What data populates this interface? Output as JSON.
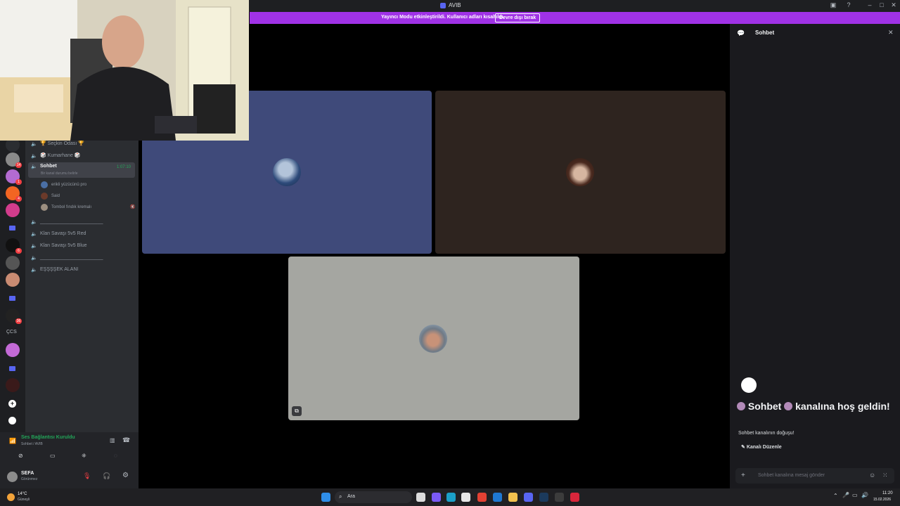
{
  "window": {
    "title": "AVIB",
    "minimize": "–",
    "maximize": "□",
    "close": "✕"
  },
  "banner": {
    "message": "Yayıncı Modu etkinleştirildi. Kullanıcı adları kısaltıldı.",
    "button": "Devre dışı bırak"
  },
  "servers": {
    "badges": [
      "14",
      "1",
      "4",
      "6",
      "36"
    ],
    "text_server": "ÇCS"
  },
  "channels": {
    "items": [
      {
        "label": "🏆 Seçkin Odası 🏆"
      },
      {
        "label": "🎲 Kumarhane 🎲"
      },
      {
        "label": "Sohbet",
        "status": "Bir kanal durumu belirle",
        "timer": "1:07:10"
      },
      {
        "label": "_______________________"
      },
      {
        "label": "Klan Savaşı 5v5 Red"
      },
      {
        "label": "Klan Savaşı 5v5 Blue"
      },
      {
        "label": "_______________________"
      },
      {
        "label": "EŞŞŞŞEK ALANI"
      }
    ],
    "members": [
      "erikli yüzücünü pro",
      "Said",
      "Tombol fındık kremalı"
    ]
  },
  "voice": {
    "status": "Ses Bağlantısı Kuruldu",
    "channel": "Sohbet / AVIB"
  },
  "user": {
    "name": "SEFA",
    "status": "Görünmez"
  },
  "chat": {
    "header": "Sohbet",
    "welcome_a": "Sohbet",
    "welcome_b": "kanalına hoş geldin!",
    "sub_a": "Sohbet",
    "sub_b": "kanalının doğuşu!",
    "edit_button": "Kanalı Düzenle",
    "placeholder_a": "Sohbet",
    "placeholder_b": "kanalına mesaj gönder"
  },
  "taskbar": {
    "weather_temp": "14°C",
    "weather_desc": "Güneşli",
    "search": "Ara",
    "time": "11:20",
    "date": "15.02.2026"
  },
  "colors": {
    "banner": "#a032e6",
    "tile1": "#3f4a7a",
    "tile2": "#2e241f",
    "tile3": "#a5a6a1",
    "connected": "#23a559"
  }
}
